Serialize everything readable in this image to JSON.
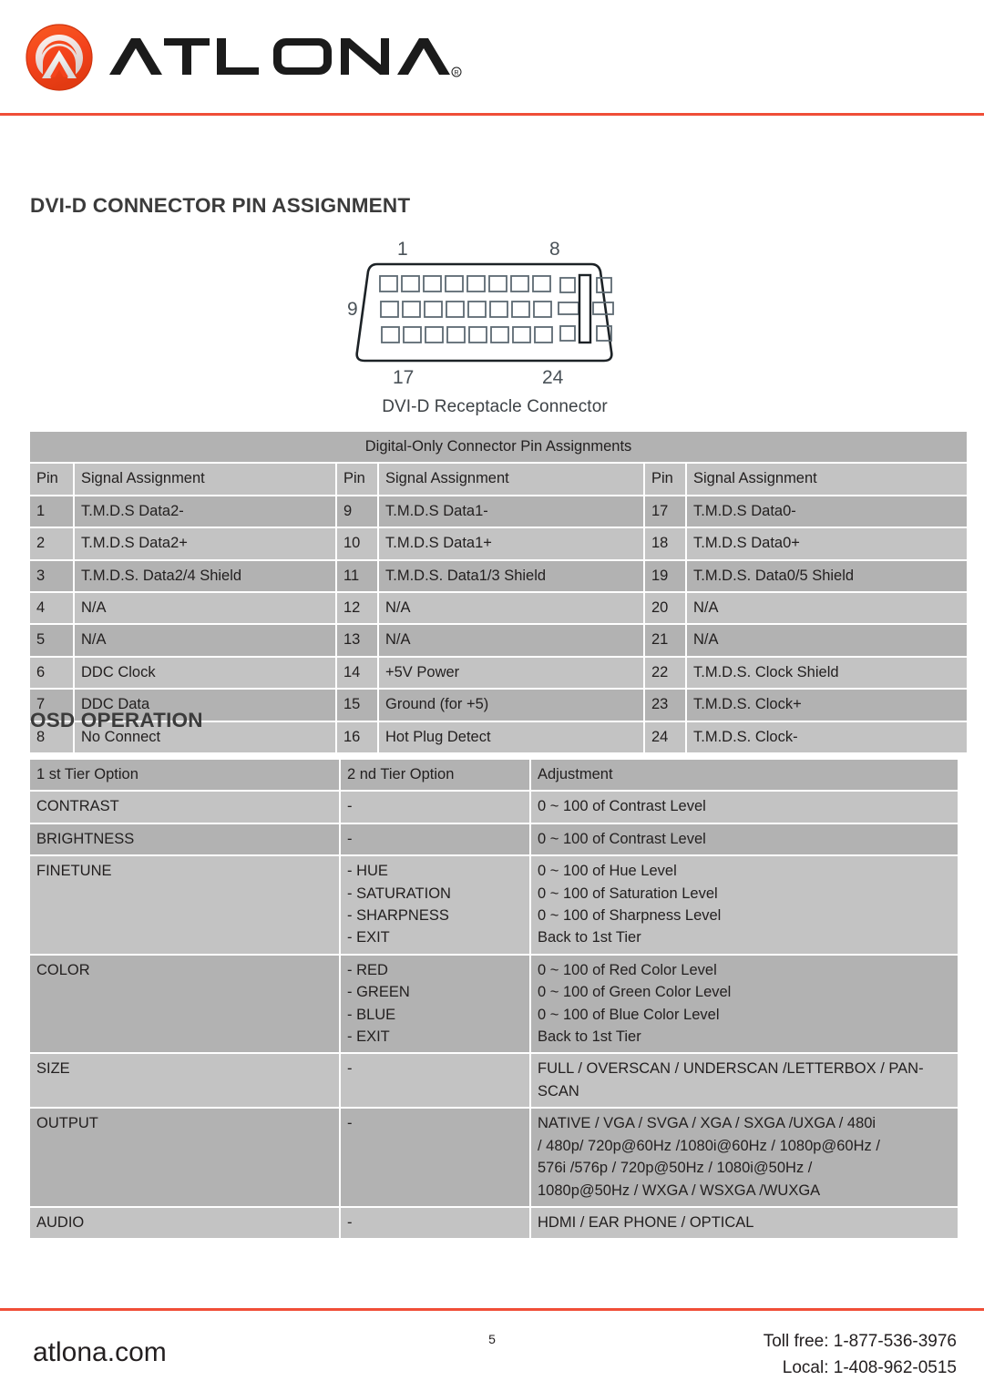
{
  "header": {
    "logo_icon": "atlona-circle-chevron-icon",
    "brand": "ATLONA",
    "brand_registered_mark": "®",
    "rule_color": "#f04e37"
  },
  "sections": {
    "dvi_heading": "DVI-D CONNECTOR PIN ASSIGNMENT",
    "osd_heading": "OSD OPERATION"
  },
  "connector_figure": {
    "caption": "DVI-D Receptacle Connector",
    "label_top_left": "1",
    "label_top_right": "8",
    "label_left": "9",
    "label_bottom_left": "17",
    "label_bottom_right": "24"
  },
  "pin_table": {
    "title": "Digital-Only Connector Pin Assignments",
    "headers": [
      "Pin",
      "Signal Assignment",
      "Pin",
      "Signal Assignment",
      "Pin",
      "Signal Assignment"
    ],
    "rows": [
      [
        "1",
        "T.M.D.S Data2-",
        "9",
        "T.M.D.S Data1-",
        "17",
        "T.M.D.S Data0-"
      ],
      [
        "2",
        "T.M.D.S Data2+",
        "10",
        "T.M.D.S Data1+",
        "18",
        "T.M.D.S Data0+"
      ],
      [
        "3",
        "T.M.D.S. Data2/4 Shield",
        "11",
        "T.M.D.S. Data1/3 Shield",
        "19",
        "T.M.D.S. Data0/5 Shield"
      ],
      [
        "4",
        "N/A",
        "12",
        "N/A",
        "20",
        "N/A"
      ],
      [
        "5",
        "N/A",
        "13",
        "N/A",
        "21",
        "N/A"
      ],
      [
        "6",
        "DDC Clock",
        "14",
        "+5V Power",
        "22",
        "T.M.D.S. Clock Shield"
      ],
      [
        "7",
        "DDC Data",
        "15",
        "Ground (for +5)",
        "23",
        "T.M.D.S. Clock+"
      ],
      [
        "8",
        "No Connect",
        "16",
        "Hot Plug Detect",
        "24",
        "T.M.D.S. Clock-"
      ]
    ]
  },
  "osd_table": {
    "headers": [
      "1 st Tier Option",
      "2 nd Tier Option",
      "Adjustment"
    ],
    "rows": [
      [
        "CONTRAST",
        "-",
        "0 ~ 100 of Contrast Level"
      ],
      [
        "BRIGHTNESS",
        "-",
        "0 ~ 100 of Contrast Level"
      ],
      [
        "FINETUNE",
        "- HUE\n- SATURATION\n- SHARPNESS\n- EXIT",
        "0 ~ 100 of Hue Level\n0 ~ 100 of Saturation Level\n0 ~ 100 of Sharpness Level\nBack to 1st Tier"
      ],
      [
        "COLOR",
        "- RED\n- GREEN\n- BLUE\n- EXIT",
        "0 ~ 100 of Red Color Level\n0 ~ 100 of Green Color Level\n0 ~ 100 of Blue Color Level\nBack to 1st Tier"
      ],
      [
        "SIZE",
        "-",
        "FULL / OVERSCAN / UNDERSCAN /LETTERBOX / PAN-\nSCAN"
      ],
      [
        "OUTPUT",
        "-",
        "NATIVE / VGA / SVGA / XGA / SXGA /UXGA / 480i\n/ 480p/ 720p@60Hz /1080i@60Hz / 1080p@60Hz /\n576i /576p / 720p@50Hz / 1080i@50Hz /\n1080p@50Hz / WXGA / WSXGA /WUXGA"
      ],
      [
        "AUDIO",
        "-",
        "HDMI / EAR PHONE / OPTICAL"
      ]
    ]
  },
  "footer": {
    "site": "atlona.com",
    "page_number": "5",
    "toll_free": "Toll free: 1-877-536-3976",
    "local": "Local: 1-408-962-0515",
    "rule_color": "#f04e37"
  },
  "colors": {
    "brand_orange": "#f4431c",
    "rule_red": "#f04e37",
    "row_dark": "#b2b2b2",
    "row_light": "#c3c3c3",
    "heading_gray": "#3b3b3b"
  }
}
